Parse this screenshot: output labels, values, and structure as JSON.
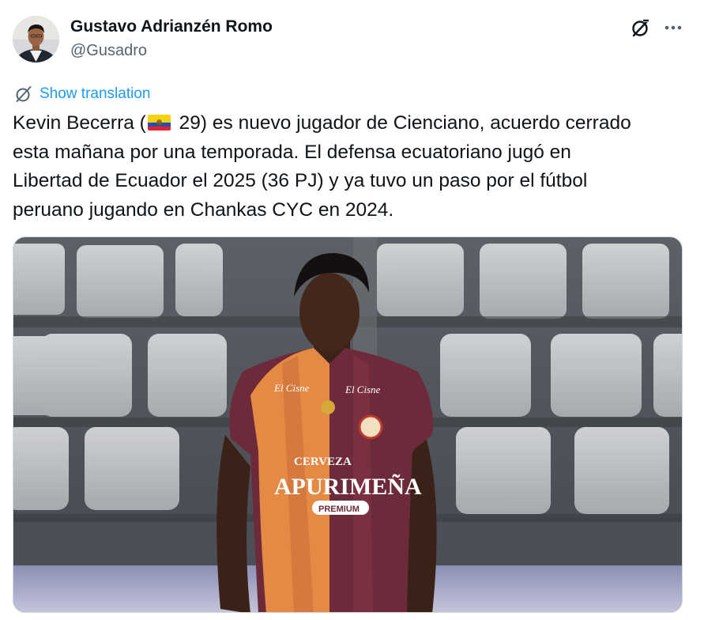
{
  "author": {
    "display_name": "Gustavo Adrianzén Romo",
    "handle": "@Gusadro",
    "avatar": "profile-photo"
  },
  "actions": {
    "grok_icon": "grok-icon",
    "more_icon": "more-dots-icon"
  },
  "translation": {
    "label": "Show translation",
    "icon": "translate-icon"
  },
  "tweet": {
    "line1_a": "Kevin Becerra (",
    "flag": "Ecuador flag emoji",
    "line1_b": " 29) es nuevo jugador de Cienciano, acuerdo cerrado",
    "line2": "esta mañana por una temporada. El defensa ecuatoriano jugó en",
    "line3": "Libertad de Ecuador el 2025 (36 PJ) y ya tuvo un paso por el fútbol",
    "line4": "peruano jugando en Chankas CYC en 2024."
  },
  "media": {
    "description_icon": "football-player-photo",
    "jersey_brand_1": "CERVEZA",
    "jersey_brand_2": "APURIMEÑA",
    "jersey_brand_3": "•PREMIUM•",
    "sponsor": "El Cisne"
  },
  "colors": {
    "accent": "#1d9bf0",
    "text_primary": "#0f1419",
    "text_secondary": "#536471",
    "border": "#cfd9de"
  }
}
